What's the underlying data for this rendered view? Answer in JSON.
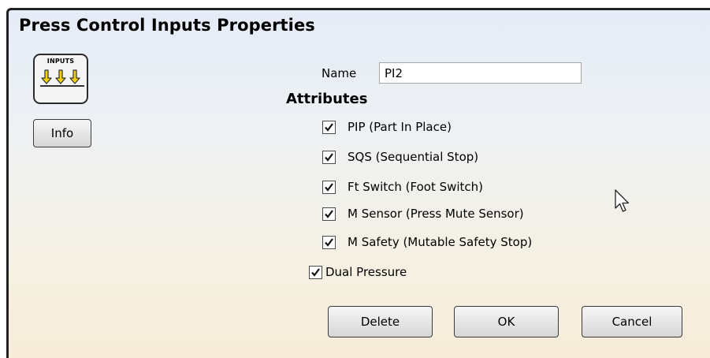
{
  "dialog": {
    "title": "Press Control Inputs Properties",
    "icon_label": "INPUTS",
    "icon_name": "inputs-arrows-icon",
    "info_label": "Info"
  },
  "name_field": {
    "label": "Name",
    "value": "PI2"
  },
  "attributes": {
    "heading": "Attributes",
    "items": [
      {
        "label": "PIP (Part In Place)",
        "checked": true
      },
      {
        "label": "SQS (Sequential Stop)",
        "checked": true
      },
      {
        "label": "Ft Switch (Foot Switch)",
        "checked": true
      },
      {
        "label": "M Sensor (Press Mute Sensor)",
        "checked": true
      },
      {
        "label": "M Safety (Mutable Safety Stop)",
        "checked": true
      }
    ]
  },
  "dual_pressure": {
    "label": "Dual Pressure",
    "checked": true
  },
  "buttons": {
    "delete": "Delete",
    "ok": "OK",
    "cancel": "Cancel"
  },
  "colors": {
    "arrow_fill": "#f5d20a",
    "background_top": "#e4ecf7",
    "background_bottom": "#f7ecd8"
  }
}
